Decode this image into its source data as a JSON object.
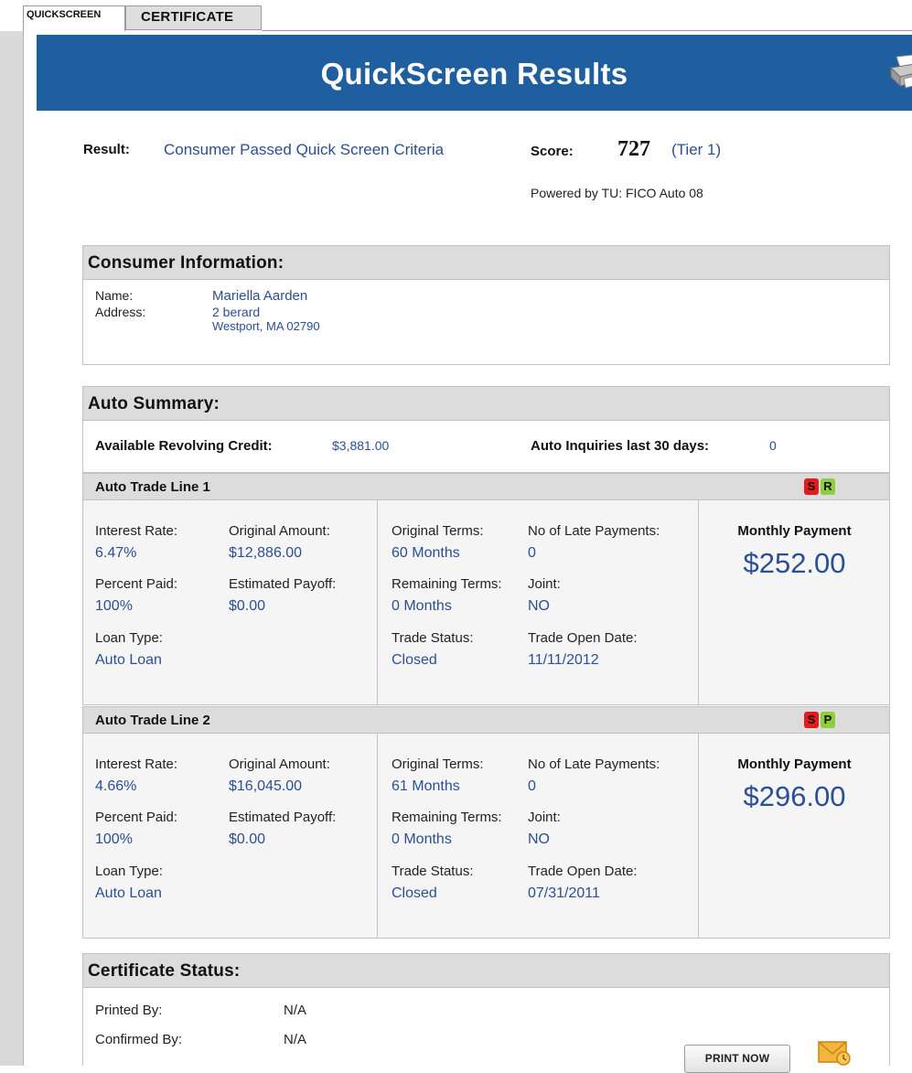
{
  "tabs": {
    "quickscreen": "QUICKSCREEN",
    "certificate": "CERTIFICATE"
  },
  "banner": {
    "title": "QuickScreen Results"
  },
  "result": {
    "label": "Result:",
    "value": "Consumer Passed Quick Screen Criteria",
    "score_label": "Score:",
    "score": "727",
    "tier": "(Tier 1)",
    "powered_by": "Powered by TU: FICO Auto 08"
  },
  "consumer": {
    "header": "Consumer Information:",
    "name_label": "Name:",
    "name": "Mariella Aarden",
    "address_label": "Address:",
    "address_line1": "2 berard",
    "address_line2": "Westport, MA 02790"
  },
  "auto_summary": {
    "header": "Auto Summary:",
    "revolving_label": "Available Revolving Credit:",
    "revolving_value": "$3,881.00",
    "inquiries_label": "Auto Inquiries last 30 days:",
    "inquiries_value": "0"
  },
  "field_labels": {
    "interest_rate": "Interest Rate:",
    "original_amount": "Original Amount:",
    "percent_paid": "Percent Paid:",
    "estimated_payoff": "Estimated Payoff:",
    "loan_type": "Loan Type:",
    "original_terms": "Original Terms:",
    "late_payments": "No of Late Payments:",
    "remaining_terms": "Remaining Terms:",
    "joint": "Joint:",
    "trade_status": "Trade Status:",
    "trade_open_date": "Trade Open Date:",
    "monthly_payment": "Monthly Payment"
  },
  "trade_lines": [
    {
      "title": "Auto Trade Line 1",
      "badges": [
        "S",
        "R"
      ],
      "interest_rate": "6.47%",
      "original_amount": "$12,886.00",
      "percent_paid": "100%",
      "estimated_payoff": "$0.00",
      "loan_type": "Auto Loan",
      "original_terms": "60 Months",
      "late_payments": "0",
      "remaining_terms": "0 Months",
      "joint": "NO",
      "trade_status": "Closed",
      "trade_open_date": "11/11/2012",
      "monthly_payment": "$252.00"
    },
    {
      "title": "Auto Trade Line 2",
      "badges": [
        "S",
        "P"
      ],
      "interest_rate": "4.66%",
      "original_amount": "$16,045.00",
      "percent_paid": "100%",
      "estimated_payoff": "$0.00",
      "loan_type": "Auto Loan",
      "original_terms": "61 Months",
      "late_payments": "0",
      "remaining_terms": "0 Months",
      "joint": "NO",
      "trade_status": "Closed",
      "trade_open_date": "07/31/2011",
      "monthly_payment": "$296.00"
    }
  ],
  "certificate": {
    "header": "Certificate Status:",
    "printed_by_label": "Printed By:",
    "printed_by": "N/A",
    "confirmed_by_label": "Confirmed By:",
    "confirmed_by": "N/A",
    "print_button": "PRINT NOW"
  },
  "icons": {
    "printer": "printer-icon",
    "email": "email-icon"
  },
  "colors": {
    "banner": "#1f5fa0",
    "value_text": "#2a4f94",
    "badge_red": "#e51a1a",
    "badge_green": "#8ccf3a"
  }
}
